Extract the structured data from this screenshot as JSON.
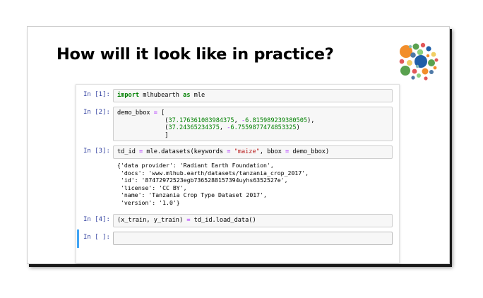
{
  "slide": {
    "title": "How will it look like in practice?"
  },
  "logo": {
    "icon": "colorful-dots-logo-icon",
    "colors": [
      "#f28e2b",
      "#59a14f",
      "#4e79a7",
      "#e15759",
      "#8cd17d",
      "#1f5fa8",
      "#f1ce63",
      "#86bcb6"
    ]
  },
  "notebook": {
    "cells": [
      {
        "prompt": "In [1]:",
        "code": [
          [
            {
              "t": "import",
              "c": "kw"
            },
            {
              "t": " mlhubearth "
            },
            {
              "t": "as",
              "c": "kw"
            },
            {
              "t": " mle"
            }
          ]
        ]
      },
      {
        "prompt": "In [2]:",
        "code": [
          [
            {
              "t": "demo_bbox "
            },
            {
              "t": "=",
              "c": "op"
            },
            {
              "t": " ["
            }
          ],
          [
            {
              "t": "             ("
            },
            {
              "t": "37.176361083984375",
              "c": "num"
            },
            {
              "t": ", "
            },
            {
              "t": "-",
              "c": "op"
            },
            {
              "t": "6.815989239380505",
              "c": "num"
            },
            {
              "t": "),"
            }
          ],
          [
            {
              "t": "             ("
            },
            {
              "t": "37.24365234375",
              "c": "num"
            },
            {
              "t": ", "
            },
            {
              "t": "-",
              "c": "op"
            },
            {
              "t": "6.7559877474853325",
              "c": "num"
            },
            {
              "t": ")"
            }
          ],
          [
            {
              "t": "             ]"
            }
          ]
        ]
      },
      {
        "prompt": "In [3]:",
        "code": [
          [
            {
              "t": "td_id "
            },
            {
              "t": "=",
              "c": "op"
            },
            {
              "t": " mle.datasets(keywords "
            },
            {
              "t": "=",
              "c": "op"
            },
            {
              "t": " "
            },
            {
              "t": "\"maize\"",
              "c": "str"
            },
            {
              "t": ", bbox "
            },
            {
              "t": "=",
              "c": "op"
            },
            {
              "t": " demo_bbox)"
            }
          ]
        ],
        "output": [
          "{'data provider': 'Radiant Earth Foundation',",
          " 'docs': 'www.mlhub.earth/datasets/tanzania_crop_2017',",
          " 'id': '87472972523egb7365288157394uyhs6352527e',",
          " 'license': 'CC BY',",
          " 'name': 'Tanzania Crop Type Dataset 2017',",
          " 'version': '1.0'}"
        ]
      },
      {
        "prompt": "In [4]:",
        "code": [
          [
            {
              "t": "(x_train, y_train) "
            },
            {
              "t": "=",
              "c": "op"
            },
            {
              "t": " td_id.load_data()"
            }
          ]
        ]
      },
      {
        "prompt": "In [ ]:",
        "code": [
          [
            {
              "t": ""
            }
          ]
        ]
      }
    ]
  }
}
